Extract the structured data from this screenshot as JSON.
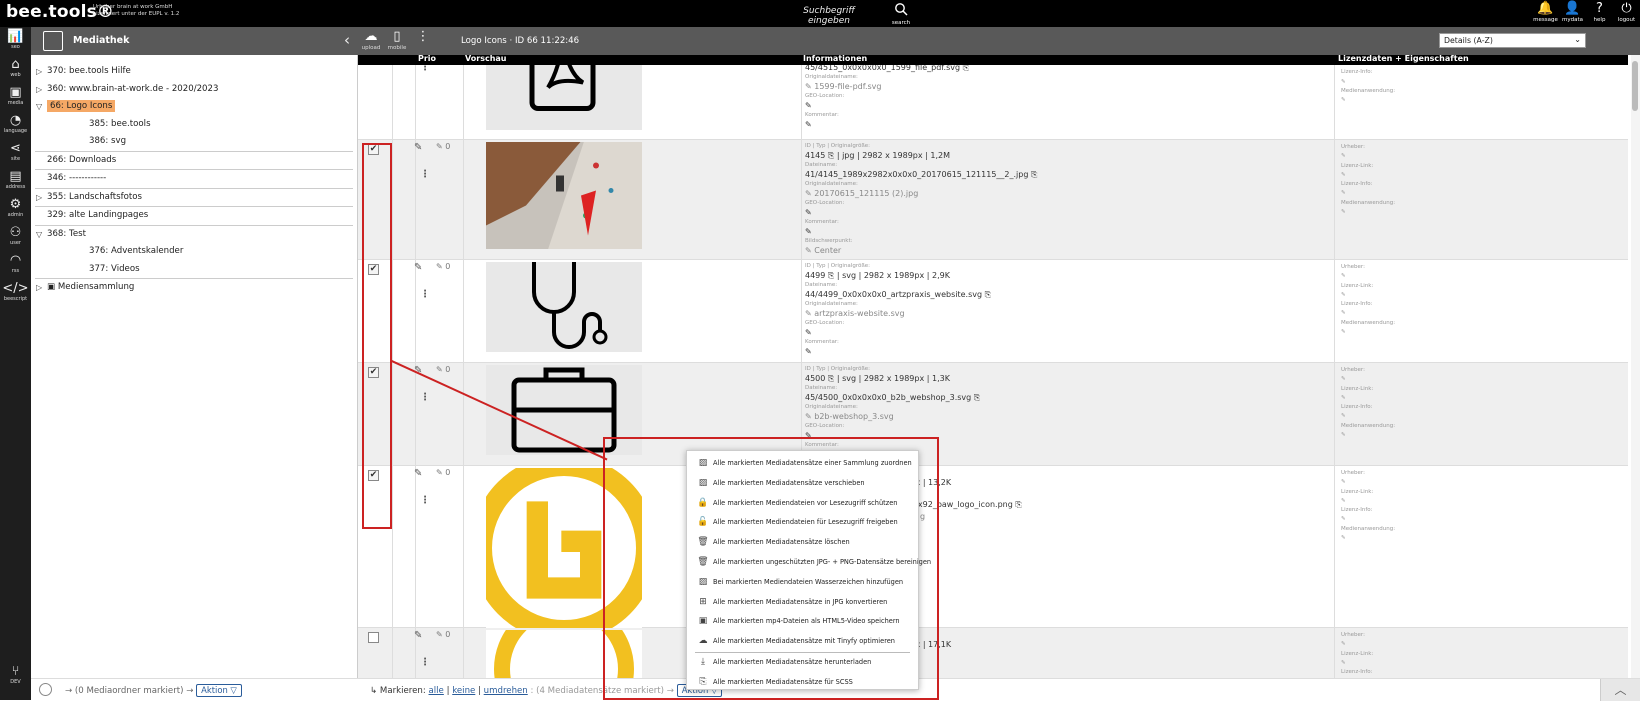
{
  "app": {
    "brand": "bee.tools®",
    "license_line1": "Urheber brain at work GmbH",
    "license_line2": "Lizenziert unter der EUPL v. 1.2",
    "search_placeholder": "Suchbegriff eingeben",
    "search_label": "search"
  },
  "top_icons": [
    {
      "icon": "bell-icon",
      "glyph": "🔔",
      "label": "message"
    },
    {
      "icon": "user-icon",
      "glyph": "👤",
      "label": "mydata"
    },
    {
      "icon": "help-icon",
      "glyph": "?",
      "label": "help"
    },
    {
      "icon": "power-icon",
      "glyph": "⏻",
      "label": "logout"
    }
  ],
  "left_nav": [
    {
      "icon": "chart-icon",
      "glyph": "📊",
      "label": "seo"
    },
    {
      "icon": "home-icon",
      "glyph": "⌂",
      "label": "web"
    },
    {
      "icon": "image-icon",
      "glyph": "▣",
      "label": "media"
    },
    {
      "icon": "language-icon",
      "glyph": "◔",
      "label": "language"
    },
    {
      "icon": "share-icon",
      "glyph": "⋖",
      "label": "site"
    },
    {
      "icon": "address-icon",
      "glyph": "▤",
      "label": "address"
    },
    {
      "icon": "gear-icon",
      "glyph": "⚙",
      "label": "admin"
    },
    {
      "icon": "users-icon",
      "glyph": "⚇",
      "label": "user"
    },
    {
      "icon": "rss-icon",
      "glyph": "◠",
      "label": "rss"
    },
    {
      "icon": "code-icon",
      "glyph": "</>",
      "label": "beescript"
    }
  ],
  "left_nav_dev": {
    "icon": "branch-icon",
    "glyph": "⑂",
    "label": "DEV"
  },
  "panel": {
    "title": "Mediathek",
    "tree": [
      {
        "label": "370: bee.tools Hilfe",
        "level": 0,
        "toggle": "▷"
      },
      {
        "label": "360: www.brain-at-work.de - 2020/2023",
        "level": 0,
        "toggle": "▷"
      },
      {
        "label": "66: Logo Icons",
        "level": 0,
        "toggle": "▽",
        "selected": true
      },
      {
        "label": "385: bee.tools",
        "level": 1
      },
      {
        "label": "386: svg",
        "level": 1
      },
      {
        "sep": true
      },
      {
        "label": "266: Downloads",
        "level": 0
      },
      {
        "sep": true
      },
      {
        "label": "346: ------------",
        "level": 0
      },
      {
        "sep": true
      },
      {
        "label": "355: Landschaftsfotos",
        "level": 0,
        "toggle": "▷"
      },
      {
        "sep": true
      },
      {
        "label": "329: alte Landingpages",
        "level": 0
      },
      {
        "sep": true
      },
      {
        "label": "368: Test",
        "level": 0,
        "toggle": "▽"
      },
      {
        "label": "376: Adventskalender",
        "level": 1
      },
      {
        "label": "377: Videos",
        "level": 1
      },
      {
        "sep": true
      },
      {
        "label": "Mediensammlung",
        "level": 0,
        "toggle": "▷",
        "folder": true
      }
    ],
    "bottom_text": "→ (0 Mediaordner markiert) →",
    "bottom_action": "Aktion ▽"
  },
  "toolbar": {
    "upload": "upload",
    "mobile": "mobile",
    "breadcrumb": "Logo Icons · ID 66 11:22:46",
    "sort": "Details (A-Z)"
  },
  "columns": {
    "prio": "Prio",
    "preview": "Vorschau",
    "info": "Informationen",
    "license": "Lizenzdaten + Eigenschaften"
  },
  "labels": {
    "id_type_size": "ID | Typ | Originalgröße:",
    "filename": "Dateiname:",
    "original_filename": "Originaldateiname:",
    "geo": "GEO-Location:",
    "comment": "Kommentar:",
    "focus": "Bildschwerpunkt:",
    "author": "Urheber:",
    "license_link": "Lizenz-Link:",
    "license_info": "Lizenz-Info:",
    "media_use": "Medienanwendung:"
  },
  "rows": [
    {
      "checked": false,
      "prio": "",
      "id": "",
      "type": "",
      "size": "",
      "filename": "45/4515_0x0x0x0x0_1599_file_pdf.svg",
      "original": "1599-file-pdf.svg",
      "thumb": "pdf"
    },
    {
      "checked": true,
      "prio": "0",
      "id": "4145",
      "type": "jpg",
      "size": "2982 x 1989px | 1,2M",
      "filename": "41/4145_1989x2982x0x0x0_20170615_121115__2_.jpg",
      "original": "20170615_121115 (2).jpg",
      "focus": "Center",
      "thumb": "photo"
    },
    {
      "checked": true,
      "prio": "0",
      "id": "4499",
      "type": "svg",
      "size": "2982 x 1989px | 2,9K",
      "filename": "44/4499_0x0x0x0x0_artzpraxis_website.svg",
      "original": "artzpraxis-website.svg",
      "thumb": "stethoscope"
    },
    {
      "checked": true,
      "prio": "0",
      "id": "4500",
      "type": "svg",
      "size": "2982 x 1989px | 1,3K",
      "filename": "45/4500_0x0x0x0x0_b2b_webshop_3.svg",
      "original": "b2b-webshop_3.svg",
      "thumb": "briefcase"
    },
    {
      "checked": true,
      "prio": "0",
      "id": "",
      "type": "",
      "size": "x 40px | 13,2K",
      "filename": "x72x92_baw_logo_icon.png",
      "original": "g",
      "thumb": "logo"
    },
    {
      "checked": false,
      "prio": "0",
      "id": "",
      "type": "",
      "size": "x 40px | 17,1K",
      "filename": "",
      "original": "",
      "thumb": "logo2"
    }
  ],
  "context_menu": [
    {
      "icon": "image-icon",
      "glyph": "▨",
      "label": "Alle markierten Mediadatensätze einer Sammlung zuordnen"
    },
    {
      "icon": "move-icon",
      "glyph": "▨",
      "label": "Alle markierten Mediadatensätze verschieben"
    },
    {
      "icon": "lock-icon",
      "glyph": "🔒",
      "label": "Alle markierten Mediendateien vor Lesezugriff schützen"
    },
    {
      "icon": "unlock-icon",
      "glyph": "🔓",
      "label": "Alle markierten Mediendateien für Lesezugriff freigeben"
    },
    {
      "icon": "trash-icon",
      "glyph": "🗑",
      "label": "Alle markierten Mediadatensätze löschen"
    },
    {
      "icon": "trash-icon",
      "glyph": "🗑",
      "label": "Alle markierten ungeschützten JPG- + PNG-Datensätze bereinigen"
    },
    {
      "icon": "watermark-icon",
      "glyph": "▨",
      "label": "Bei markierten Mediendateien Wasserzeichen hinzufügen"
    },
    {
      "icon": "convert-icon",
      "glyph": "⊞",
      "label": "Alle markierten Mediadatensätze in JPG konvertieren"
    },
    {
      "icon": "video-icon",
      "glyph": "▣",
      "label": "Alle markierten mp4-Dateien als HTML5-Video speichern"
    },
    {
      "icon": "tinify-icon",
      "glyph": "☁",
      "label": "Alle markierten Mediadatensätze mit Tinyfy optimieren"
    },
    {
      "sep": true
    },
    {
      "icon": "download-icon",
      "glyph": "⤓",
      "label": "Alle markierten Mediadatensätze herunterladen"
    },
    {
      "icon": "scss-icon",
      "glyph": "⎘",
      "label": "Alle markierten Mediadatensätze für SCSS"
    }
  ],
  "bottom": {
    "prefix": "↳ Markieren:",
    "all": "alle",
    "none": "keine",
    "invert": "umdrehen",
    "count": ": (4 Mediadatensätze markiert) →",
    "action": "Aktion ▽"
  }
}
